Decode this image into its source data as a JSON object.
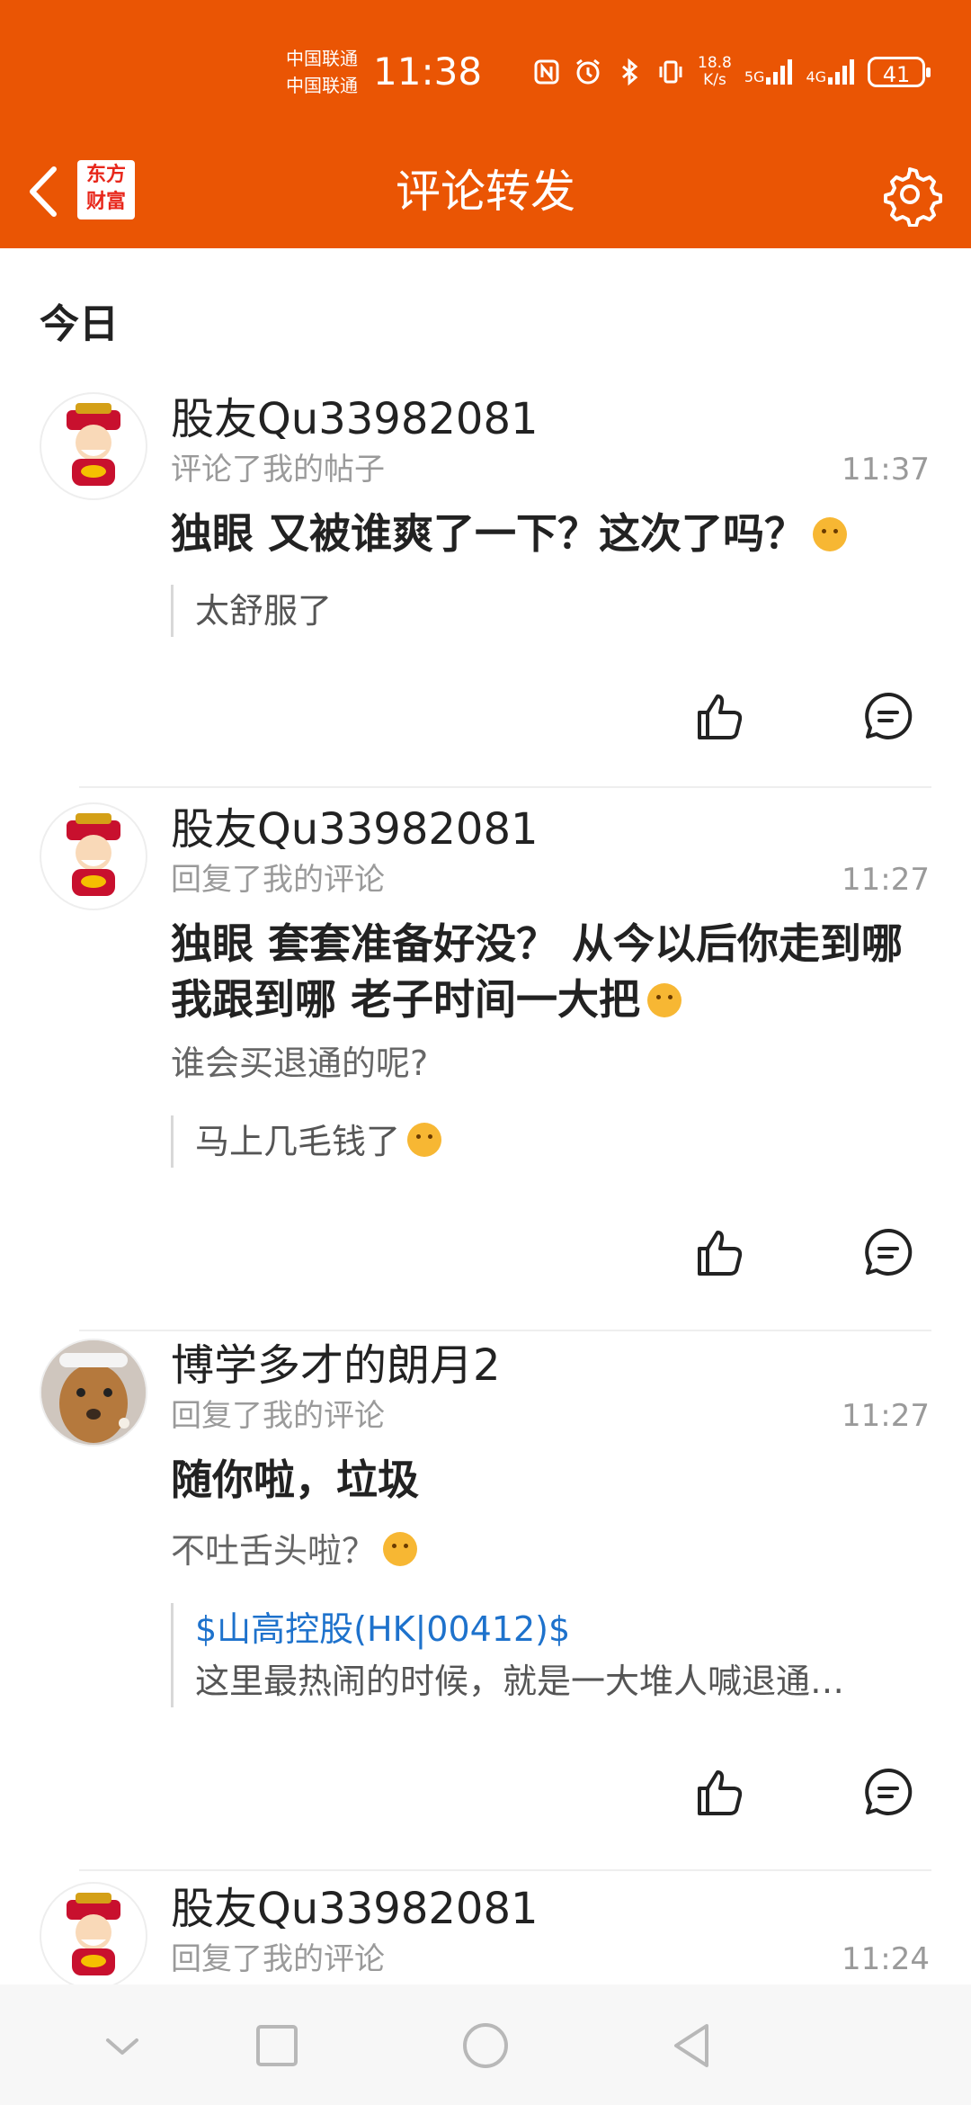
{
  "status_bar": {
    "carrier_1": "中国联通",
    "carrier_2": "中国联通",
    "time": "11:38",
    "net_speed_value": "18.8",
    "net_speed_unit": "K/s",
    "signal_1": "5G",
    "signal_2": "4G",
    "battery": "41"
  },
  "header": {
    "logo_line1": "东方",
    "logo_line2": "财富",
    "title": "评论转发",
    "icons": [
      "back-arrow-icon",
      "gear-icon"
    ],
    "background_color": "#ea5504"
  },
  "section": {
    "title": "今日"
  },
  "items": [
    {
      "username": "股友Qu33982081",
      "action": "评论了我的帖子",
      "time": "11:37",
      "text": "独眼 又被谁爽了一下？这次了吗？",
      "quote": "太舒服了"
    },
    {
      "username": "股友Qu33982081",
      "action": "回复了我的评论",
      "time": "11:27",
      "text": "独眼 套套准备好没？ 从今以后你走到哪我跟到哪 老子时间一大把",
      "sub_text": "谁会买退通的呢?",
      "quote": "马上几毛钱了"
    },
    {
      "username": "博学多才的朗月2",
      "action": "回复了我的评论",
      "time": "11:27",
      "text": "随你啦，垃圾",
      "sub_text": "不吐舌头啦？",
      "quote_link": "$山高控股(HK|00412)$",
      "quote": "这里最热闹的时候，就是一大堆人喊退通…"
    },
    {
      "username": "股友Qu33982081",
      "action": "回复了我的评论",
      "time": "11:24"
    }
  ],
  "accent_color": "#1e72cc"
}
